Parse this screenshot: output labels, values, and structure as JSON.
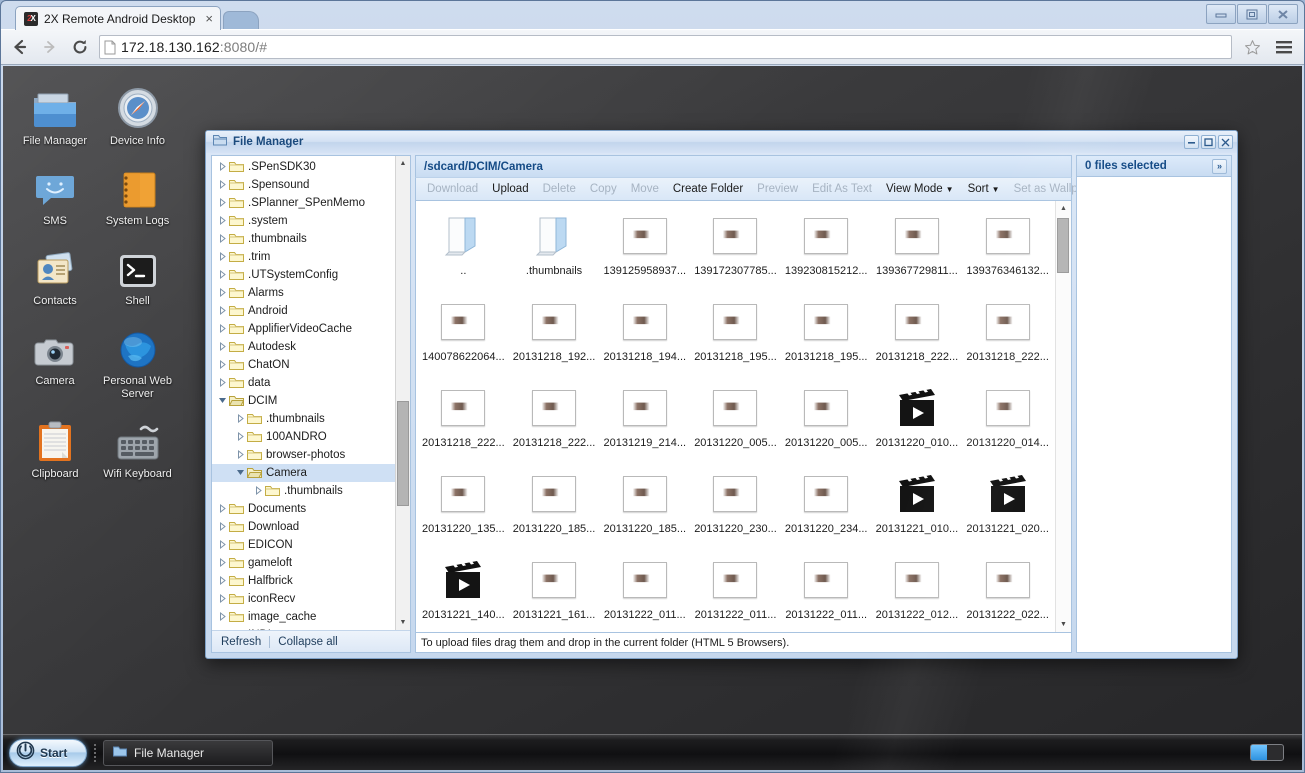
{
  "browser": {
    "tab": {
      "title": "2X Remote Android Desktop",
      "favicon": "2x-logo-favicon",
      "close": "×"
    },
    "url_main": "172.18.130.162",
    "url_rest": ":8080/#",
    "nav": {
      "back": "back-arrow-icon",
      "forward": "forward-arrow-icon",
      "reload": "reload-icon"
    },
    "star": "bookmark-star-icon",
    "menu": "hamburger-menu-icon",
    "window": {
      "minimize": "minimize",
      "maximize": "maximize",
      "close": "close"
    }
  },
  "desktop": {
    "icons": [
      {
        "label": "File Manager",
        "icon": "folder-icon"
      },
      {
        "label": "Device Info",
        "icon": "compass-icon"
      },
      {
        "label": "SMS",
        "icon": "message-bubble-icon"
      },
      {
        "label": "System Logs",
        "icon": "notebook-icon"
      },
      {
        "label": "Contacts",
        "icon": "contact-card-icon"
      },
      {
        "label": "Shell",
        "icon": "terminal-icon"
      },
      {
        "label": "Camera",
        "icon": "camera-icon"
      },
      {
        "label": "Personal Web Server",
        "icon": "globe-icon"
      },
      {
        "label": "Clipboard",
        "icon": "clipboard-icon"
      },
      {
        "label": "Wifi Keyboard",
        "icon": "keyboard-icon"
      }
    ]
  },
  "taskbar": {
    "start_label": "Start",
    "start_icon": "power-icon",
    "tasks": [
      {
        "label": "File Manager",
        "icon": "folder-icon"
      }
    ],
    "tray_toggle": "toggle-switch"
  },
  "file_manager": {
    "title": "File Manager",
    "title_icon": "window-folder-icon",
    "window_buttons": {
      "minimize": "–",
      "maximize": "□",
      "close": "✕"
    },
    "path": "/sdcard/DCIM/Camera",
    "toolbar": [
      {
        "label": "Download",
        "enabled": false,
        "menu": false
      },
      {
        "label": "Upload",
        "enabled": true,
        "menu": false
      },
      {
        "label": "Delete",
        "enabled": false,
        "menu": false
      },
      {
        "label": "Copy",
        "enabled": false,
        "menu": false
      },
      {
        "label": "Move",
        "enabled": false,
        "menu": false
      },
      {
        "label": "Create Folder",
        "enabled": true,
        "menu": false
      },
      {
        "label": "Preview",
        "enabled": false,
        "menu": false
      },
      {
        "label": "Edit As Text",
        "enabled": false,
        "menu": false
      },
      {
        "label": "View Mode",
        "enabled": true,
        "menu": true
      },
      {
        "label": "Sort",
        "enabled": true,
        "menu": true
      },
      {
        "label": "Set as Wallpaper",
        "enabled": false,
        "menu": false
      }
    ],
    "tree": [
      {
        "label": ".SPenSDK30",
        "depth": 1,
        "expanded": false,
        "selected": false
      },
      {
        "label": ".Spensound",
        "depth": 1,
        "expanded": false,
        "selected": false
      },
      {
        "label": ".SPlanner_SPenMemo",
        "depth": 1,
        "expanded": false,
        "selected": false
      },
      {
        "label": ".system",
        "depth": 1,
        "expanded": false,
        "selected": false
      },
      {
        "label": ".thumbnails",
        "depth": 1,
        "expanded": false,
        "selected": false
      },
      {
        "label": ".trim",
        "depth": 1,
        "expanded": false,
        "selected": false
      },
      {
        "label": ".UTSystemConfig",
        "depth": 1,
        "expanded": false,
        "selected": false
      },
      {
        "label": "Alarms",
        "depth": 1,
        "expanded": false,
        "selected": false
      },
      {
        "label": "Android",
        "depth": 1,
        "expanded": false,
        "selected": false
      },
      {
        "label": "ApplifierVideoCache",
        "depth": 1,
        "expanded": false,
        "selected": false
      },
      {
        "label": "Autodesk",
        "depth": 1,
        "expanded": false,
        "selected": false
      },
      {
        "label": "ChatON",
        "depth": 1,
        "expanded": false,
        "selected": false
      },
      {
        "label": "data",
        "depth": 1,
        "expanded": false,
        "selected": false
      },
      {
        "label": "DCIM",
        "depth": 1,
        "expanded": true,
        "selected": false
      },
      {
        "label": ".thumbnails",
        "depth": 2,
        "expanded": false,
        "selected": false
      },
      {
        "label": "100ANDRO",
        "depth": 2,
        "expanded": false,
        "selected": false
      },
      {
        "label": "browser-photos",
        "depth": 2,
        "expanded": false,
        "selected": false
      },
      {
        "label": "Camera",
        "depth": 2,
        "expanded": true,
        "selected": true
      },
      {
        "label": ".thumbnails",
        "depth": 3,
        "expanded": false,
        "selected": false
      },
      {
        "label": "Documents",
        "depth": 1,
        "expanded": false,
        "selected": false
      },
      {
        "label": "Download",
        "depth": 1,
        "expanded": false,
        "selected": false
      },
      {
        "label": "EDICON",
        "depth": 1,
        "expanded": false,
        "selected": false
      },
      {
        "label": "gameloft",
        "depth": 1,
        "expanded": false,
        "selected": false
      },
      {
        "label": "Halfbrick",
        "depth": 1,
        "expanded": false,
        "selected": false
      },
      {
        "label": "iconRecv",
        "depth": 1,
        "expanded": false,
        "selected": false
      },
      {
        "label": "image_cache",
        "depth": 1,
        "expanded": false,
        "selected": false
      },
      {
        "label": "INDI",
        "depth": 1,
        "expanded": false,
        "selected": false
      }
    ],
    "tree_footer": {
      "refresh": "Refresh",
      "collapse_all": "Collapse all"
    },
    "files": [
      {
        "name": "..",
        "type": "folder"
      },
      {
        "name": ".thumbnails",
        "type": "folder"
      },
      {
        "name": "139125958937...",
        "type": "image"
      },
      {
        "name": "139172307785...",
        "type": "image"
      },
      {
        "name": "139230815212...",
        "type": "image"
      },
      {
        "name": "139367729811...",
        "type": "image"
      },
      {
        "name": "139376346132...",
        "type": "image"
      },
      {
        "name": "140078622064...",
        "type": "image"
      },
      {
        "name": "20131218_192...",
        "type": "image"
      },
      {
        "name": "20131218_194...",
        "type": "image"
      },
      {
        "name": "20131218_195...",
        "type": "image"
      },
      {
        "name": "20131218_195...",
        "type": "image"
      },
      {
        "name": "20131218_222...",
        "type": "image"
      },
      {
        "name": "20131218_222...",
        "type": "image"
      },
      {
        "name": "20131218_222...",
        "type": "image"
      },
      {
        "name": "20131218_222...",
        "type": "image"
      },
      {
        "name": "20131219_214...",
        "type": "image"
      },
      {
        "name": "20131220_005...",
        "type": "image"
      },
      {
        "name": "20131220_005...",
        "type": "image"
      },
      {
        "name": "20131220_010...",
        "type": "video"
      },
      {
        "name": "20131220_014...",
        "type": "image"
      },
      {
        "name": "20131220_135...",
        "type": "image"
      },
      {
        "name": "20131220_185...",
        "type": "image"
      },
      {
        "name": "20131220_185...",
        "type": "image"
      },
      {
        "name": "20131220_230...",
        "type": "image"
      },
      {
        "name": "20131220_234...",
        "type": "image"
      },
      {
        "name": "20131221_010...",
        "type": "video"
      },
      {
        "name": "20131221_020...",
        "type": "video"
      },
      {
        "name": "20131221_140...",
        "type": "video"
      },
      {
        "name": "20131221_161...",
        "type": "image"
      },
      {
        "name": "20131222_011...",
        "type": "image"
      },
      {
        "name": "20131222_011...",
        "type": "image"
      },
      {
        "name": "20131222_011...",
        "type": "image"
      },
      {
        "name": "20131222_012...",
        "type": "image"
      },
      {
        "name": "20131222_022...",
        "type": "image"
      }
    ],
    "status_text": "To upload files drag them and drop in the current folder (HTML 5 Browsers).",
    "right_panel": {
      "header": "0 files selected",
      "collapse": "»"
    }
  },
  "colors": {
    "accent": "#154b86",
    "window_border": "#7da0c6",
    "tree_selection": "#cfe0f4",
    "desktop_bg": "#38383a"
  }
}
